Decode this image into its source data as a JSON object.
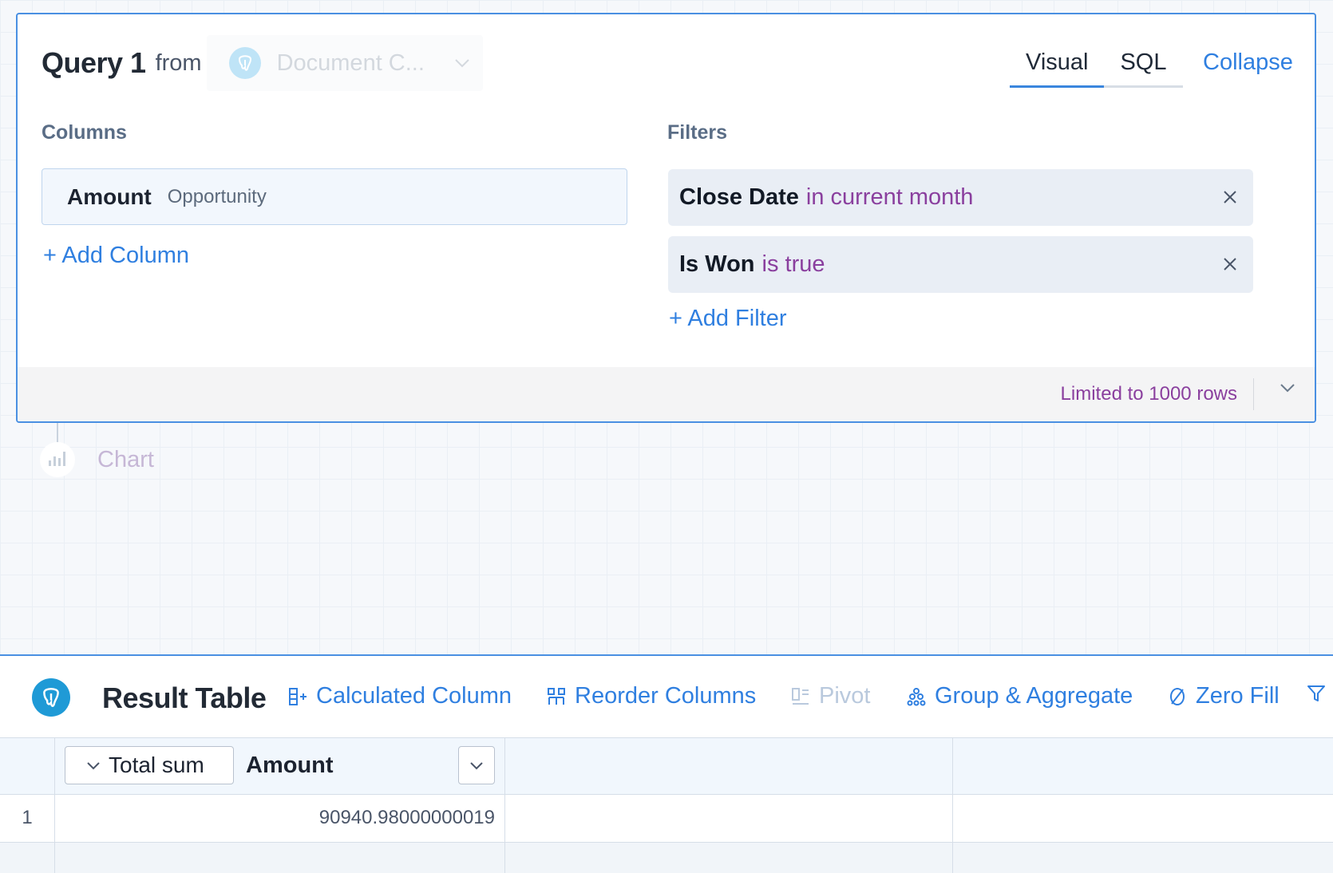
{
  "query": {
    "title": "Query 1",
    "from_label": "from",
    "source": {
      "name": "Document C...",
      "icon": "postgres-icon"
    },
    "tabs": [
      {
        "label": "Visual",
        "active": true
      },
      {
        "label": "SQL",
        "active": false
      }
    ],
    "collapse_label": "Collapse",
    "columns_label": "Columns",
    "filters_label": "Filters",
    "columns": [
      {
        "name": "Amount",
        "table": "Opportunity"
      }
    ],
    "add_column_label": "+ Add Column",
    "filters": [
      {
        "field": "Close Date",
        "operator": "in current month"
      },
      {
        "field": "Is Won",
        "operator": "is true"
      }
    ],
    "add_filter_label": "+ Add Filter",
    "limit_text": "Limited to 1000 rows"
  },
  "chart_node": {
    "label": "Chart",
    "icon": "bar-chart-icon"
  },
  "result_table": {
    "title": "Result Table",
    "icon": "postgres-icon",
    "tools": [
      {
        "label": "Calculated Column",
        "icon": "calculated-column-icon",
        "disabled": false
      },
      {
        "label": "Reorder Columns",
        "icon": "reorder-columns-icon",
        "disabled": false
      },
      {
        "label": "Pivot",
        "icon": "pivot-icon",
        "disabled": true
      },
      {
        "label": "Group & Aggregate",
        "icon": "group-aggregate-icon",
        "disabled": false
      },
      {
        "label": "Zero Fill",
        "icon": "zero-fill-icon",
        "disabled": false
      },
      {
        "label": "",
        "icon": "filter-icon",
        "disabled": false
      }
    ],
    "column": {
      "aggregation": "Total sum",
      "name": "Amount"
    },
    "rows": [
      {
        "index": "1",
        "value": "90940.98000000019"
      }
    ]
  },
  "colors": {
    "accent": "#2f7fe0",
    "card_border": "#4a90e2",
    "operator": "#8a3f9e",
    "postgres": "#1f9ad6"
  }
}
